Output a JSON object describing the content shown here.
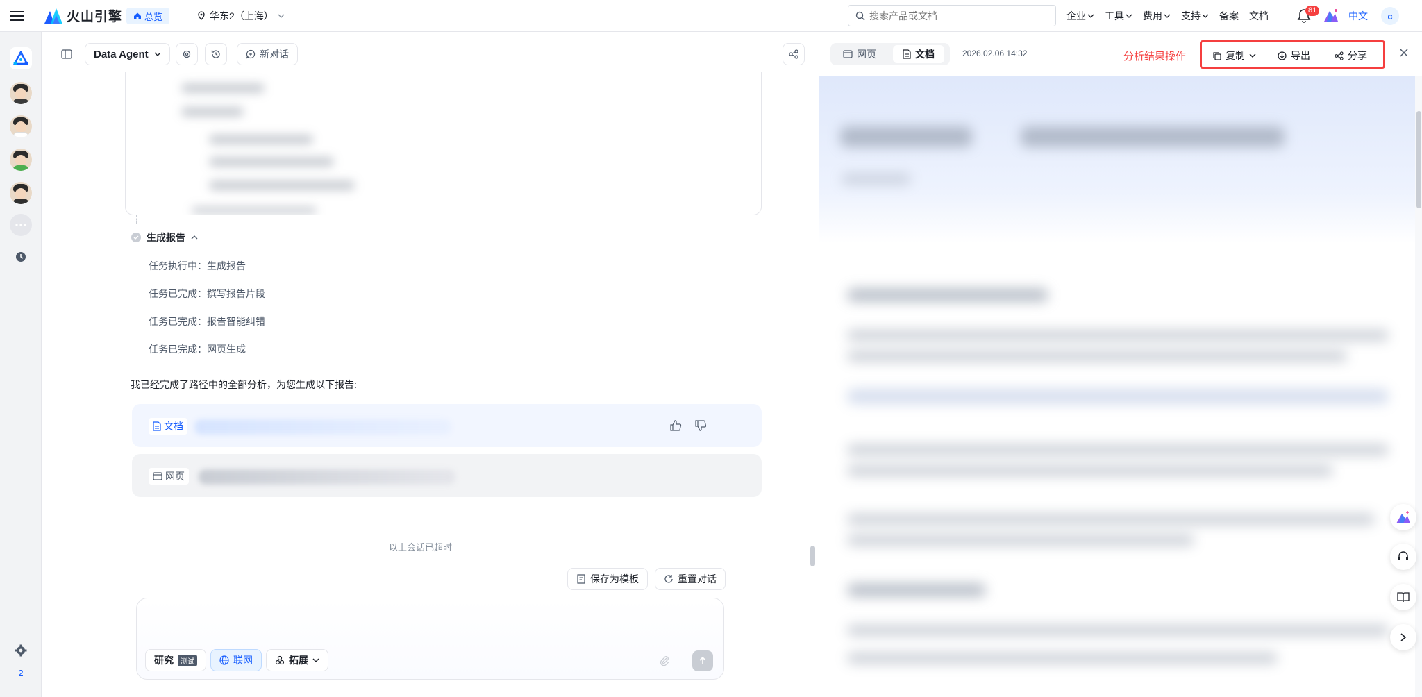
{
  "topbar": {
    "brand": "火山引擎",
    "overview_label": "总览",
    "region": "华东2（上海）",
    "search_placeholder": "搜索产品或文档",
    "nav": [
      {
        "label": "企业"
      },
      {
        "label": "工具"
      },
      {
        "label": "费用"
      },
      {
        "label": "支持"
      },
      {
        "label": "备案"
      },
      {
        "label": "文档"
      }
    ],
    "notification_count": "81",
    "language": "中文",
    "user_initial": "c"
  },
  "rail": {
    "bottom_number": "2"
  },
  "chat": {
    "agent_label": "Data Agent",
    "new_chat_label": "新对话",
    "step_title": "生成报告",
    "tasks": [
      {
        "text": "任务执行中：生成报告"
      },
      {
        "text": "任务已完成：撰写报告片段"
      },
      {
        "text": "任务已完成：报告智能纠错"
      },
      {
        "text": "任务已完成：网页生成"
      }
    ],
    "summary": "我已经完成了路径中的全部分析，为您生成以下报告:",
    "results": [
      {
        "label": "文档"
      },
      {
        "label": "网页"
      }
    ],
    "divider_text": "以上会话已超时",
    "save_template_label": "保存为模板",
    "reset_label": "重置对话",
    "composer": {
      "research_label": "研究",
      "beta_label": "测试",
      "web_label": "联网",
      "extend_label": "拓展"
    }
  },
  "result_panel": {
    "tabs": [
      {
        "label": "网页"
      },
      {
        "label": "文档"
      }
    ],
    "active_tab": "文档",
    "timestamp": "2026.02.06 14:32",
    "annotation": "分析结果操作",
    "actions": {
      "copy_label": "复制",
      "export_label": "导出",
      "share_label": "分享"
    }
  },
  "colors": {
    "accent": "#165dff",
    "annotation_red": "#f53f3f"
  }
}
